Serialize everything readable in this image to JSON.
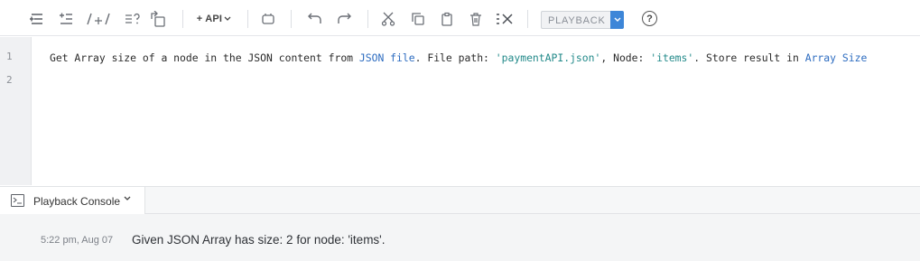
{
  "toolbar": {
    "api_label": "+ API",
    "playback_label": "PLAYBACK",
    "help_label": "?",
    "icons": [
      "add-step-icon",
      "insert-step-icon",
      "comment-toggle-icon",
      "list-help-icon",
      "convert-icon",
      "api-icon",
      "record-icon",
      "undo-icon",
      "redo-icon",
      "cut-icon",
      "copy-icon",
      "paste-icon",
      "delete-icon",
      "clear-icon",
      "help-icon"
    ]
  },
  "editor": {
    "line_numbers": [
      "1",
      "2"
    ],
    "line1": {
      "t1": "Get Array size of a node in the JSON content from ",
      "link1": "JSON file",
      "t2": ". File path: ",
      "path": "'paymentAPI.json'",
      "t3": ", Node: ",
      "node": "'items'",
      "t4": ". Store result in ",
      "link2": "Array Size"
    }
  },
  "console": {
    "title": "Playback Console",
    "entries": [
      {
        "time": "5:22 pm, Aug 07",
        "message": "Given JSON Array has size: 2 for node: 'items'."
      }
    ]
  },
  "colors": {
    "accent": "#3d86d8",
    "link": "#2d6cc0",
    "string": "#238a8a",
    "gutter_bg": "#f0f1f3"
  }
}
